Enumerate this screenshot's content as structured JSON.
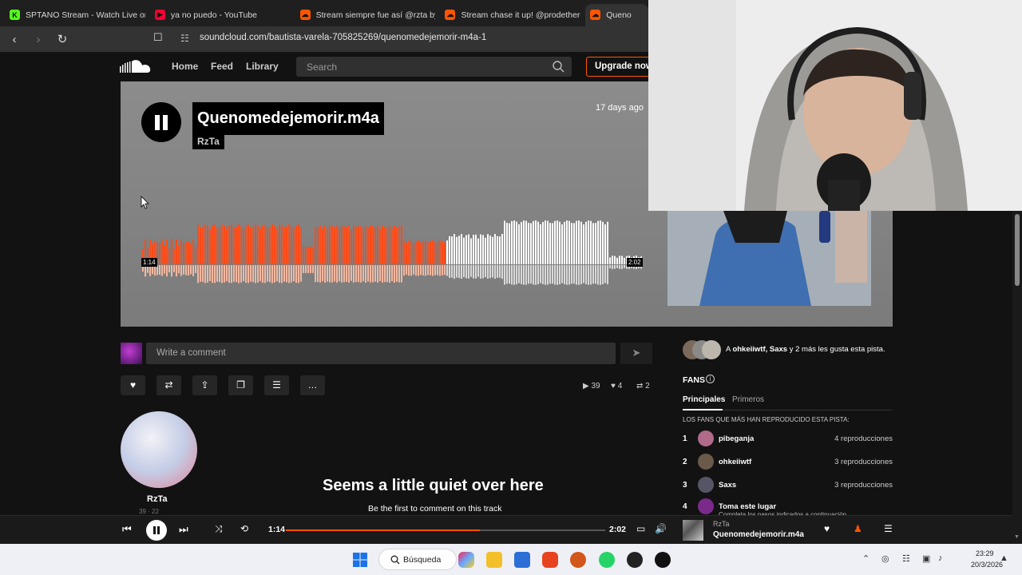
{
  "browser": {
    "tabs": [
      {
        "title": "SPTANO Stream - Watch Live on K",
        "favicon_color": "#53fc18",
        "favicon_glyph": "K"
      },
      {
        "title": "ya no puedo - YouTube",
        "favicon_color": "#ff0033",
        "favicon_glyph": "▶"
      },
      {
        "title": "Stream siempre fue así @rzta by p",
        "favicon_color": "#ff5500",
        "favicon_glyph": "☁"
      },
      {
        "title": "Stream chase it up! @prodetherea",
        "favicon_color": "#ff5500",
        "favicon_glyph": "☁"
      },
      {
        "title": "Queno",
        "favicon_color": "#ff5500",
        "favicon_glyph": "☁",
        "active": true
      }
    ],
    "url": "soundcloud.com/bautista-varela-705825269/quenomedejemorir-m4a-1"
  },
  "header": {
    "nav": [
      "Home",
      "Feed",
      "Library"
    ],
    "search_placeholder": "Search",
    "upgrade_label": "Upgrade now"
  },
  "track": {
    "title": "Quenomedejemorir.m4a",
    "artist": "RzTa",
    "posted": "17 days ago",
    "current_time": "1:14",
    "duration": "2:02",
    "progress": 0.607
  },
  "comment": {
    "placeholder": "Write a comment"
  },
  "stats": {
    "plays": "39",
    "likes": "4",
    "reposts": "2"
  },
  "uploader": {
    "name": "RzTa",
    "meta": "39 · 22"
  },
  "empty_comments": {
    "title": "Seems a little quiet over here",
    "subtitle": "Be the first to comment on this track"
  },
  "sidebar": {
    "likes_prefix": "A ",
    "likes_names": "ohkeiiwtf, Saxs",
    "likes_suffix": " y 2 más les gusta esta pista.",
    "fans_heading": "FANS",
    "fan_tabs": [
      "Principales",
      "Primeros"
    ],
    "fans_caption": "LOS FANS QUE MÁS HAN REPRODUCIDO ESTA PISTA:",
    "fans": [
      {
        "rank": "1",
        "name": "pibeganja",
        "plays": "4 reproducciones",
        "avatar_color": "#b06a8a"
      },
      {
        "rank": "2",
        "name": "ohkeiiwtf",
        "plays": "3 reproducciones",
        "avatar_color": "#6b5a4a"
      },
      {
        "rank": "3",
        "name": "Saxs",
        "plays": "3 reproducciones",
        "avatar_color": "#555566"
      },
      {
        "rank": "4",
        "name": "Toma este lugar",
        "plays": "",
        "extra": "Completa los pasos indicados a continuación",
        "avatar_color": "#7a2a8a"
      }
    ]
  },
  "player": {
    "current_time": "1:14",
    "duration": "2:02",
    "progress": 0.607,
    "artist": "RzTa",
    "title": "Quenomedejemorir.m4a"
  },
  "taskbar": {
    "search_label": "Búsqueda",
    "time": "23:29",
    "date": "20/3/2026"
  },
  "colors": {
    "accent": "#ff5500",
    "played_wave": "#ff4c1a",
    "unplayed_wave": "#ffffff"
  }
}
